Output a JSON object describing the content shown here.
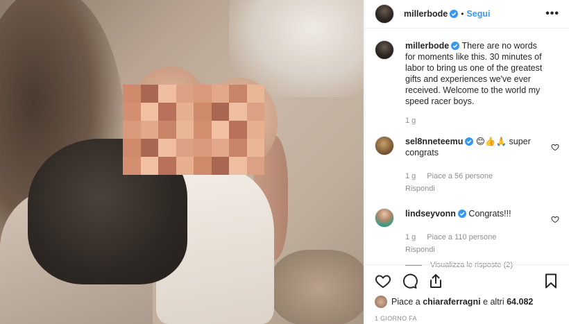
{
  "post": {
    "author": "millerbode",
    "follow_label": "Segui",
    "dot": "•",
    "more_label": "•••",
    "caption": "There are no words for moments like this. 30 minutes of labor to bring us one of the greatest gifts and experiences we've ever received. Welcome to the world my speed racer boys.",
    "caption_time": "1 g"
  },
  "comments": [
    {
      "user": "sel8nneteemu",
      "text": "😊👍🙏 super congrats",
      "time": "1 g",
      "likes": "Piace a 56 persone",
      "reply": "Rispondi"
    },
    {
      "user": "lindseyvonn",
      "text": "Congrats!!!",
      "time": "1 g",
      "likes": "Piace a 110 persone",
      "reply": "Rispondi"
    }
  ],
  "view_replies": "Visualizza le risposte (2)",
  "liked_by": {
    "prefix": "Piace a ",
    "user": "chiaraferragni",
    "suffix": " e altri ",
    "count": "64.082"
  },
  "date": "1 GIORNO FA",
  "icons": [
    "heart-icon",
    "comment-icon",
    "share-icon",
    "bookmark-icon",
    "verified-icon"
  ],
  "colors": {
    "accent": "#3897f0",
    "muted": "#8e8e8e",
    "text": "#262626"
  }
}
